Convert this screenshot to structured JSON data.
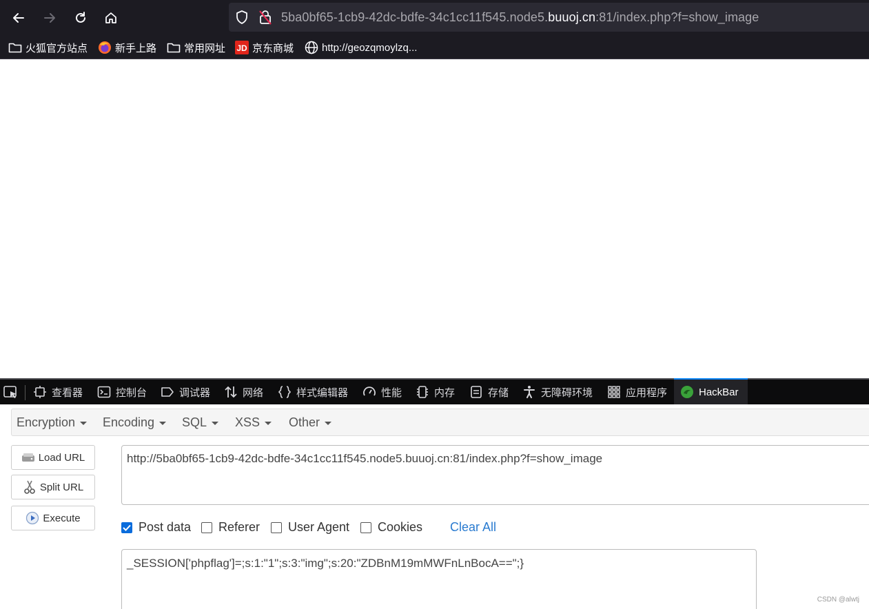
{
  "browser": {
    "url": {
      "prefix": "5ba0bf65-1cb9-42dc-bdfe-34c1cc11f545.node5.",
      "host": "buuoj.cn",
      "suffix": ":81/index.php?f=show_image"
    },
    "bookmarks": [
      {
        "label": "火狐官方站点",
        "icon": "folder-icon"
      },
      {
        "label": "新手上路",
        "icon": "firefox-icon"
      },
      {
        "label": "常用网址",
        "icon": "folder-icon"
      },
      {
        "label": "京东商城",
        "icon": "jd-icon"
      },
      {
        "label": "http://geozqmoylzq...",
        "icon": "globe-icon"
      }
    ]
  },
  "devtools": {
    "tabs": [
      {
        "label": "查看器",
        "icon": "inspector-icon"
      },
      {
        "label": "控制台",
        "icon": "console-icon"
      },
      {
        "label": "调试器",
        "icon": "debugger-icon"
      },
      {
        "label": "网络",
        "icon": "network-icon"
      },
      {
        "label": "样式编辑器",
        "icon": "style-editor-icon"
      },
      {
        "label": "性能",
        "icon": "performance-icon"
      },
      {
        "label": "内存",
        "icon": "memory-icon"
      },
      {
        "label": "存储",
        "icon": "storage-icon"
      },
      {
        "label": "无障碍环境",
        "icon": "accessibility-icon"
      },
      {
        "label": "应用程序",
        "icon": "application-icon"
      },
      {
        "label": "HackBar",
        "icon": "hackbar-icon",
        "active": true
      }
    ]
  },
  "hackbar": {
    "menu": [
      "Encryption",
      "Encoding",
      "SQL",
      "XSS",
      "Other"
    ],
    "buttons": {
      "load_url": "Load URL",
      "split_url": "Split URL",
      "execute": "Execute"
    },
    "url_value": "http://5ba0bf65-1cb9-42dc-bdfe-34c1cc11f545.node5.buuoj.cn:81/index.php?f=show_image",
    "options": [
      {
        "label": "Post data",
        "checked": true
      },
      {
        "label": "Referer",
        "checked": false
      },
      {
        "label": "User Agent",
        "checked": false
      },
      {
        "label": "Cookies",
        "checked": false
      }
    ],
    "clear_all": "Clear All",
    "post_value": "_SESSION['phpflag']=;s:1:\"1\";s:3:\"img\";s:20:\"ZDBnM19mMWFnLnBocA==\";}"
  },
  "watermark": "CSDN @alwtj",
  "colors": {
    "chrome_bg": "#1c1b22",
    "urlbar_bg": "#2b2a33",
    "devtools_bg": "#0c0c0d",
    "accent": "#0a84ff",
    "link": "#2a7bd0"
  }
}
